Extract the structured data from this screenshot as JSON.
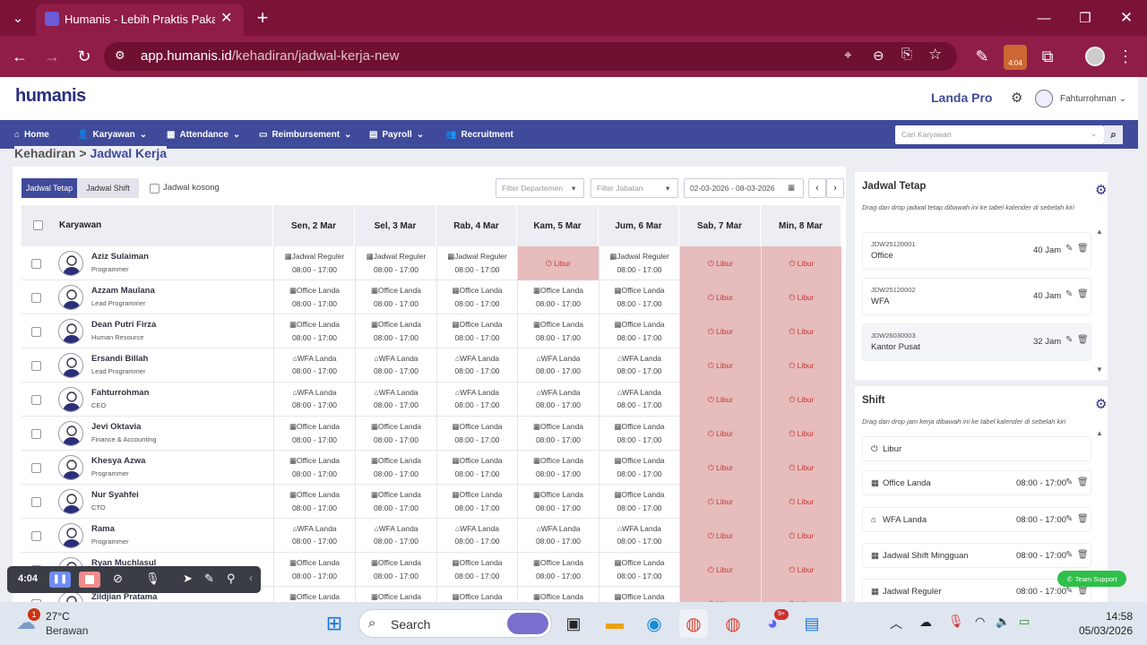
{
  "browser": {
    "tab_title": "Humanis - Lebih Praktis Pakai H",
    "url_domain": "app.humanis.id",
    "url_path": "/kehadiran/jadwal-kerja-new",
    "ext_badge": "4:04"
  },
  "app": {
    "logo": "humanis",
    "company": "Landa Pro",
    "user": "Fahturrohman",
    "search_placeholder": "Cari Karyawan",
    "menu": [
      "Home",
      "Karyawan",
      "Attendance",
      "Reimbursement",
      "Payroll",
      "Recruitment"
    ],
    "breadcrumb": {
      "parent": "Kehadiran",
      "sep": ">",
      "current": "Jadwal Kerja"
    }
  },
  "toolbar": {
    "tab_fixed": "Jadwal Tetap",
    "tab_shift": "Jadwal Shift",
    "empty_label": "Jadwal kosong",
    "filter_dept": "Filter Departemen",
    "filter_job": "Filter Jabatan",
    "date_range": "02-03-2026 - 08-03-2026"
  },
  "table": {
    "col_employee": "Karyawan",
    "days": [
      "Sen, 2 Mar",
      "Sel, 3 Mar",
      "Rab, 4 Mar",
      "Kam, 5 Mar",
      "Jum, 6 Mar",
      "Sab, 7 Mar",
      "Min, 8 Mar"
    ],
    "rows": [
      {
        "name": "Aziz Sulaiman",
        "role": "Programmer",
        "cells": [
          [
            "Jadwal Reguler",
            "08:00 - 17:00"
          ],
          [
            "Jadwal Reguler",
            "08:00 - 17:00"
          ],
          [
            "Jadwal Reguler",
            "08:00 - 17:00"
          ],
          [
            "Libur",
            ""
          ],
          [
            "Jadwal Reguler",
            "08:00 - 17:00"
          ],
          [
            "Libur",
            ""
          ],
          [
            "Libur",
            ""
          ]
        ]
      },
      {
        "name": "Azzam Maulana",
        "role": "Lead Programmer",
        "cells": [
          [
            "Office Landa",
            "08:00 - 17:00"
          ],
          [
            "Office Landa",
            "08:00 - 17:00"
          ],
          [
            "Office Landa",
            "08:00 - 17:00"
          ],
          [
            "Office Landa",
            "08:00 - 17:00"
          ],
          [
            "Office Landa",
            "08:00 - 17:00"
          ],
          [
            "Libur",
            ""
          ],
          [
            "Libur",
            ""
          ]
        ]
      },
      {
        "name": "Dean Putri Firza",
        "role": "Human Resource",
        "cells": [
          [
            "Office Landa",
            "08:00 - 17:00"
          ],
          [
            "Office Landa",
            "08:00 - 17:00"
          ],
          [
            "Office Landa",
            "08:00 - 17:00"
          ],
          [
            "Office Landa",
            "08:00 - 17:00"
          ],
          [
            "Office Landa",
            "08:00 - 17:00"
          ],
          [
            "Libur",
            ""
          ],
          [
            "Libur",
            ""
          ]
        ]
      },
      {
        "name": "Ersandi Billah",
        "role": "Lead Programmer",
        "cells": [
          [
            "WFA Landa",
            "08:00 - 17:00"
          ],
          [
            "WFA Landa",
            "08:00 - 17:00"
          ],
          [
            "WFA Landa",
            "08:00 - 17:00"
          ],
          [
            "WFA Landa",
            "08:00 - 17:00"
          ],
          [
            "WFA Landa",
            "08:00 - 17:00"
          ],
          [
            "Libur",
            ""
          ],
          [
            "Libur",
            ""
          ]
        ]
      },
      {
        "name": "Fahturrohman",
        "role": "CEO",
        "cells": [
          [
            "WFA Landa",
            "08:00 - 17:00"
          ],
          [
            "WFA Landa",
            "08:00 - 17:00"
          ],
          [
            "WFA Landa",
            "08:00 - 17:00"
          ],
          [
            "WFA Landa",
            "08:00 - 17:00"
          ],
          [
            "WFA Landa",
            "08:00 - 17:00"
          ],
          [
            "Libur",
            ""
          ],
          [
            "Libur",
            ""
          ]
        ]
      },
      {
        "name": "Jevi Oktavia",
        "role": "Finance & Accounting",
        "cells": [
          [
            "Office Landa",
            "08:00 - 17:00"
          ],
          [
            "Office Landa",
            "08:00 - 17:00"
          ],
          [
            "Office Landa",
            "08:00 - 17:00"
          ],
          [
            "Office Landa",
            "08:00 - 17:00"
          ],
          [
            "Office Landa",
            "08:00 - 17:00"
          ],
          [
            "Libur",
            ""
          ],
          [
            "Libur",
            ""
          ]
        ]
      },
      {
        "name": "Khesya Azwa",
        "role": "Programmer",
        "cells": [
          [
            "Office Landa",
            "08:00 - 17:00"
          ],
          [
            "Office Landa",
            "08:00 - 17:00"
          ],
          [
            "Office Landa",
            "08:00 - 17:00"
          ],
          [
            "Office Landa",
            "08:00 - 17:00"
          ],
          [
            "Office Landa",
            "08:00 - 17:00"
          ],
          [
            "Libur",
            ""
          ],
          [
            "Libur",
            ""
          ]
        ]
      },
      {
        "name": "Nur Syahfei",
        "role": "CTO",
        "cells": [
          [
            "Office Landa",
            "08:00 - 17:00"
          ],
          [
            "Office Landa",
            "08:00 - 17:00"
          ],
          [
            "Office Landa",
            "08:00 - 17:00"
          ],
          [
            "Office Landa",
            "08:00 - 17:00"
          ],
          [
            "Office Landa",
            "08:00 - 17:00"
          ],
          [
            "Libur",
            ""
          ],
          [
            "Libur",
            ""
          ]
        ]
      },
      {
        "name": "Rama",
        "role": "Programmer",
        "cells": [
          [
            "WFA Landa",
            "08:00 - 17:00"
          ],
          [
            "WFA Landa",
            "08:00 - 17:00"
          ],
          [
            "WFA Landa",
            "08:00 - 17:00"
          ],
          [
            "WFA Landa",
            "08:00 - 17:00"
          ],
          [
            "WFA Landa",
            "08:00 - 17:00"
          ],
          [
            "Libur",
            ""
          ],
          [
            "Libur",
            ""
          ]
        ]
      },
      {
        "name": "Ryan Muchlasul",
        "role": "",
        "cells": [
          [
            "Office Landa",
            "08:00 - 17:00"
          ],
          [
            "Office Landa",
            "08:00 - 17:00"
          ],
          [
            "Office Landa",
            "08:00 - 17:00"
          ],
          [
            "Office Landa",
            "08:00 - 17:00"
          ],
          [
            "Office Landa",
            "08:00 - 17:00"
          ],
          [
            "Libur",
            ""
          ],
          [
            "Libur",
            ""
          ]
        ]
      },
      {
        "name": "Zildjian Pratama",
        "role": "",
        "cells": [
          [
            "Office Landa",
            ""
          ],
          [
            "Office Landa",
            ""
          ],
          [
            "Office Landa",
            ""
          ],
          [
            "Office Landa",
            ""
          ],
          [
            "Office Landa",
            ""
          ],
          [
            "Libur",
            ""
          ],
          [
            "Libur",
            ""
          ]
        ]
      }
    ]
  },
  "fixed_panel": {
    "title": "Jadwal Tetap",
    "desc": "Drag dan drop jadwal tetap dibawah ini ke tabel kalender di sebelah kiri",
    "items": [
      {
        "code": "JDW25120001",
        "name": "Office",
        "hours": "40 Jam"
      },
      {
        "code": "JDW25120002",
        "name": "WFA",
        "hours": "40 Jam"
      },
      {
        "code": "JDW26030003",
        "name": "Kantor Pusat",
        "hours": "32 Jam"
      }
    ]
  },
  "shift_panel": {
    "title": "Shift",
    "desc": "Drag dan drop jam kerja dibawah ini ke tabel kalender di sebelah kiri",
    "items": [
      {
        "name": "Libur",
        "time": ""
      },
      {
        "name": "Office Landa",
        "time": "08:00 - 17:00"
      },
      {
        "name": "WFA Landa",
        "time": "08:00 - 17:00"
      },
      {
        "name": "Jadwal Shift Mingguan",
        "time": "08:00 - 17:00"
      },
      {
        "name": "Jadwal Reguler",
        "time": "08:00 - 17:00"
      }
    ]
  },
  "support_label": "Team Support",
  "recorder": {
    "time": "4:04"
  },
  "taskbar": {
    "weather_temp": "27°C",
    "weather_desc": "Berawan",
    "weather_badge": "1",
    "search": "Search",
    "discord_badge": "9+",
    "time": "14:58",
    "date": "05/03/2026"
  },
  "colors": {
    "brand_nav": "#3f4a9b",
    "browser": "#8f1d47",
    "holiday": "#e6bcbc",
    "holiday_text": "#cc3333"
  }
}
